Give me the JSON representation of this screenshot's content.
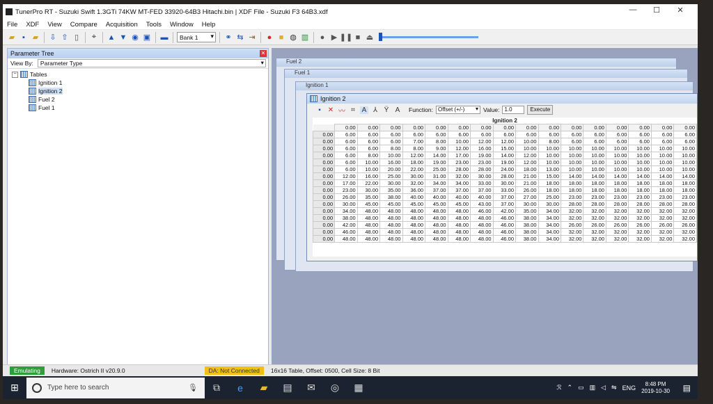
{
  "window": {
    "title": "TunerPro RT - Suzuki Swift 1.3GTi 74KW MT-FED 33920-64B3 Hitachi.bin | XDF File - Suzuki F3 64B3.xdf",
    "controls": [
      "—",
      "☐",
      "✕"
    ]
  },
  "menu": [
    "File",
    "XDF",
    "View",
    "Compare",
    "Acquisition",
    "Tools",
    "Window",
    "Help"
  ],
  "toolbar": {
    "bank": "Bank 1",
    "icons": [
      "open-icon",
      "save-icon",
      "folder-icon",
      "import-icon",
      "export-icon",
      "new-icon",
      "pin-icon",
      "up-arrow-icon",
      "down-arrow-icon",
      "emulate-icon",
      "chip-icon",
      "display-icon",
      "connect-icon",
      "swap-icon",
      "exit-icon",
      "record-icon",
      "stop-icon",
      "globe-icon",
      "chart-icon",
      "circle-icon",
      "play-icon",
      "pause-icon",
      "stop2-icon",
      "eject-icon"
    ]
  },
  "param_tree": {
    "title": "Parameter Tree",
    "view_by_label": "View By:",
    "view_by_value": "Parameter Type",
    "root": "Tables",
    "items": [
      "Ignition 1",
      "Ignition 2",
      "Fuel 2",
      "Fuel 1"
    ],
    "selected": "Ignition 2"
  },
  "stack_windows": [
    "Fuel 2",
    "Fuel 1",
    "Ignition 1"
  ],
  "ignition2": {
    "title": "Ignition 2",
    "function_label": "Function:",
    "function_value": "Offset (+/-)",
    "value_label": "Value:",
    "value": "1.0",
    "execute": "Execute",
    "grid_title": "Ignition 2",
    "col_headers": [
      "0.00",
      "0.00",
      "0.00",
      "0.00",
      "0.00",
      "0.00",
      "0.00",
      "0.00",
      "0.00",
      "0.00",
      "0.00",
      "0.00",
      "0.00",
      "0.00",
      "0.00",
      "0.00"
    ],
    "row_headers": [
      "0.00",
      "0.00",
      "0.00",
      "0.00",
      "0.00",
      "0.00",
      "0.00",
      "0.00",
      "0.00",
      "0.00",
      "0.00",
      "0.00",
      "0.00",
      "0.00",
      "0.00",
      "0.00"
    ],
    "rows": [
      [
        "6.00",
        "6.00",
        "6.00",
        "6.00",
        "6.00",
        "6.00",
        "6.00",
        "6.00",
        "6.00",
        "6.00",
        "6.00",
        "6.00",
        "6.00",
        "6.00",
        "6.00",
        "6.00"
      ],
      [
        "6.00",
        "6.00",
        "6.00",
        "7.00",
        "8.00",
        "10.00",
        "12.00",
        "12.00",
        "10.00",
        "8.00",
        "6.00",
        "6.00",
        "6.00",
        "6.00",
        "6.00",
        "6.00"
      ],
      [
        "6.00",
        "6.00",
        "8.00",
        "8.00",
        "9.00",
        "12.00",
        "16.00",
        "15.00",
        "10.00",
        "10.00",
        "10.00",
        "10.00",
        "10.00",
        "10.00",
        "10.00",
        "10.00"
      ],
      [
        "6.00",
        "8.00",
        "10.00",
        "12.00",
        "14.00",
        "17.00",
        "19.00",
        "14.00",
        "12.00",
        "10.00",
        "10.00",
        "10.00",
        "10.00",
        "10.00",
        "10.00",
        "10.00"
      ],
      [
        "6.00",
        "10.00",
        "16.00",
        "18.00",
        "19.00",
        "23.00",
        "23.00",
        "19.00",
        "12.00",
        "10.00",
        "10.00",
        "10.00",
        "10.00",
        "10.00",
        "10.00",
        "10.00"
      ],
      [
        "6.00",
        "10.00",
        "20.00",
        "22.00",
        "25.00",
        "28.00",
        "28.00",
        "24.00",
        "18.00",
        "13.00",
        "10.00",
        "10.00",
        "10.00",
        "10.00",
        "10.00",
        "10.00"
      ],
      [
        "12.00",
        "16.00",
        "25.00",
        "30.00",
        "31.00",
        "32.00",
        "30.00",
        "28.00",
        "21.00",
        "15.00",
        "14.00",
        "14.00",
        "14.00",
        "14.00",
        "14.00",
        "14.00"
      ],
      [
        "17.00",
        "22.00",
        "30.00",
        "32.00",
        "34.00",
        "34.00",
        "33.00",
        "30.00",
        "21.00",
        "18.00",
        "18.00",
        "18.00",
        "18.00",
        "18.00",
        "18.00",
        "18.00"
      ],
      [
        "23.00",
        "30.00",
        "35.00",
        "36.00",
        "37.00",
        "37.00",
        "37.00",
        "33.00",
        "26.00",
        "18.00",
        "18.00",
        "18.00",
        "18.00",
        "18.00",
        "18.00",
        "18.00"
      ],
      [
        "26.00",
        "35.00",
        "38.00",
        "40.00",
        "40.00",
        "40.00",
        "40.00",
        "37.00",
        "27.00",
        "25.00",
        "23.00",
        "23.00",
        "23.00",
        "23.00",
        "23.00",
        "23.00"
      ],
      [
        "30.00",
        "45.00",
        "45.00",
        "45.00",
        "45.00",
        "45.00",
        "43.00",
        "37.00",
        "30.00",
        "30.00",
        "28.00",
        "28.00",
        "28.00",
        "28.00",
        "28.00",
        "28.00"
      ],
      [
        "34.00",
        "48.00",
        "48.00",
        "48.00",
        "48.00",
        "48.00",
        "46.00",
        "42.00",
        "35.00",
        "34.00",
        "32.00",
        "32.00",
        "32.00",
        "32.00",
        "32.00",
        "32.00"
      ],
      [
        "38.00",
        "48.00",
        "48.00",
        "48.00",
        "48.00",
        "48.00",
        "48.00",
        "46.00",
        "38.00",
        "34.00",
        "32.00",
        "32.00",
        "32.00",
        "32.00",
        "32.00",
        "32.00"
      ],
      [
        "42.00",
        "48.00",
        "48.00",
        "48.00",
        "48.00",
        "48.00",
        "48.00",
        "46.00",
        "38.00",
        "34.00",
        "26.00",
        "26.00",
        "26.00",
        "26.00",
        "26.00",
        "26.00"
      ],
      [
        "46.00",
        "48.00",
        "48.00",
        "48.00",
        "48.00",
        "48.00",
        "48.00",
        "46.00",
        "38.00",
        "34.00",
        "32.00",
        "32.00",
        "32.00",
        "32.00",
        "32.00",
        "32.00"
      ],
      [
        "48.00",
        "48.00",
        "48.00",
        "48.00",
        "48.00",
        "48.00",
        "48.00",
        "46.00",
        "38.00",
        "34.00",
        "32.00",
        "32.00",
        "32.00",
        "32.00",
        "32.00",
        "32.00"
      ]
    ]
  },
  "status": {
    "emulating": "Emulating",
    "hardware": "Hardware: Ostrich II v20.9.0",
    "da": "DA: Not Connected",
    "info": "16x16 Table, Offset: 0500,  Cell Size: 8 Bit"
  },
  "taskbar": {
    "search_placeholder": "Type here to search",
    "lang": "ENG",
    "time": "8:48 PM",
    "date": "2019-10-30"
  }
}
